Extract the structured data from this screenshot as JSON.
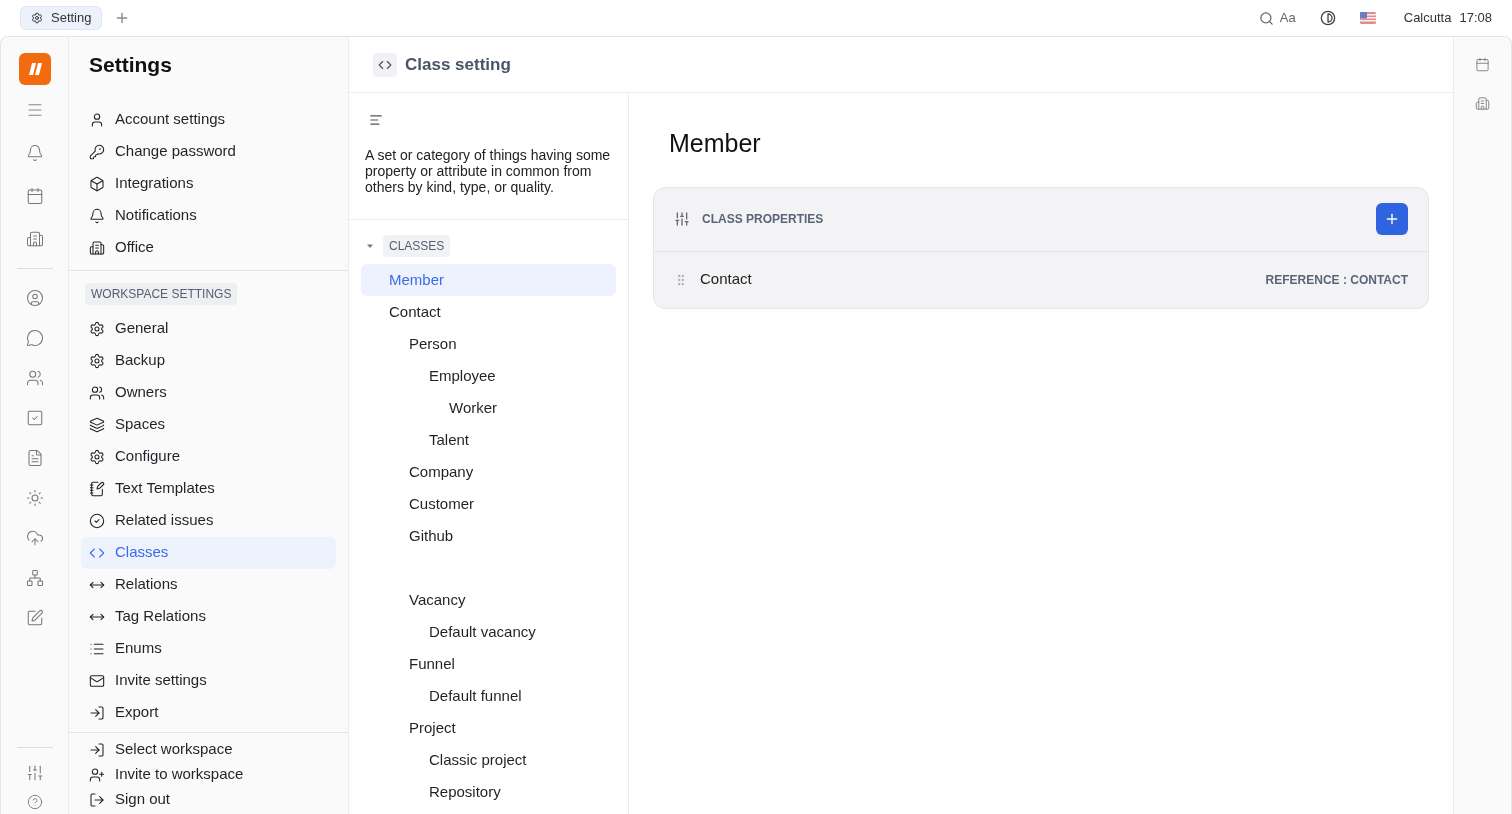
{
  "tabs": [
    {
      "label": "Setting",
      "selected": true
    }
  ],
  "top_bar": {
    "font_button": "Aa",
    "location": "Calcutta",
    "time": "17:08"
  },
  "settings": {
    "title": "Settings",
    "account_items": [
      {
        "label": "Account settings",
        "selected": false
      },
      {
        "label": "Change password",
        "selected": false
      },
      {
        "label": "Integrations",
        "selected": false
      },
      {
        "label": "Notifications",
        "selected": false
      },
      {
        "label": "Office",
        "selected": false
      }
    ],
    "workspace_header": "WORKSPACE SETTINGS",
    "workspace_items": [
      {
        "label": "General",
        "selected": false
      },
      {
        "label": "Backup",
        "selected": false
      },
      {
        "label": "Owners",
        "selected": false
      },
      {
        "label": "Spaces",
        "selected": false
      },
      {
        "label": "Configure",
        "selected": false
      },
      {
        "label": "Text Templates",
        "selected": false
      },
      {
        "label": "Related issues",
        "selected": false
      },
      {
        "label": "Classes",
        "selected": true
      },
      {
        "label": "Relations",
        "selected": false
      },
      {
        "label": "Tag Relations",
        "selected": false
      },
      {
        "label": "Enums",
        "selected": false
      },
      {
        "label": "Invite settings",
        "selected": false
      },
      {
        "label": "Export",
        "selected": false
      }
    ],
    "bottom_items": [
      {
        "label": "Select workspace"
      },
      {
        "label": "Invite to workspace"
      },
      {
        "label": "Sign out"
      }
    ]
  },
  "header": {
    "title": "Class setting"
  },
  "description": "A set or category of things having some property or attribute in common from others by kind, type, or quality.",
  "classes": {
    "label": "CLASSES",
    "expanded": true,
    "items": [
      {
        "label": "Member",
        "selected": true
      },
      {
        "label": "Contact",
        "selected": false,
        "children": [
          {
            "label": "Person",
            "selected": false,
            "children": [
              {
                "label": "Employee",
                "selected": false,
                "children": [
                  {
                    "label": "Worker",
                    "selected": false
                  }
                ]
              },
              {
                "label": "Talent",
                "selected": false
              }
            ]
          },
          {
            "label": "Company",
            "selected": false
          },
          {
            "label": "Customer",
            "selected": false
          },
          {
            "label": "Github",
            "selected": false
          }
        ]
      },
      {
        "children": [
          {
            "label": "Vacancy",
            "selected": false,
            "children": [
              {
                "label": "Default vacancy",
                "selected": false
              }
            ]
          },
          {
            "label": "Funnel",
            "selected": false,
            "children": [
              {
                "label": "Default funnel",
                "selected": false
              }
            ]
          },
          {
            "label": "Project",
            "selected": false,
            "children": [
              {
                "label": "Classic project",
                "selected": false
              },
              {
                "label": "Repository",
                "selected": false
              }
            ]
          }
        ]
      }
    ]
  },
  "detail": {
    "title": "Member",
    "properties_header": "CLASS PROPERTIES",
    "properties": [
      {
        "name": "Contact",
        "type": "REFERENCE : CONTACT"
      }
    ]
  }
}
